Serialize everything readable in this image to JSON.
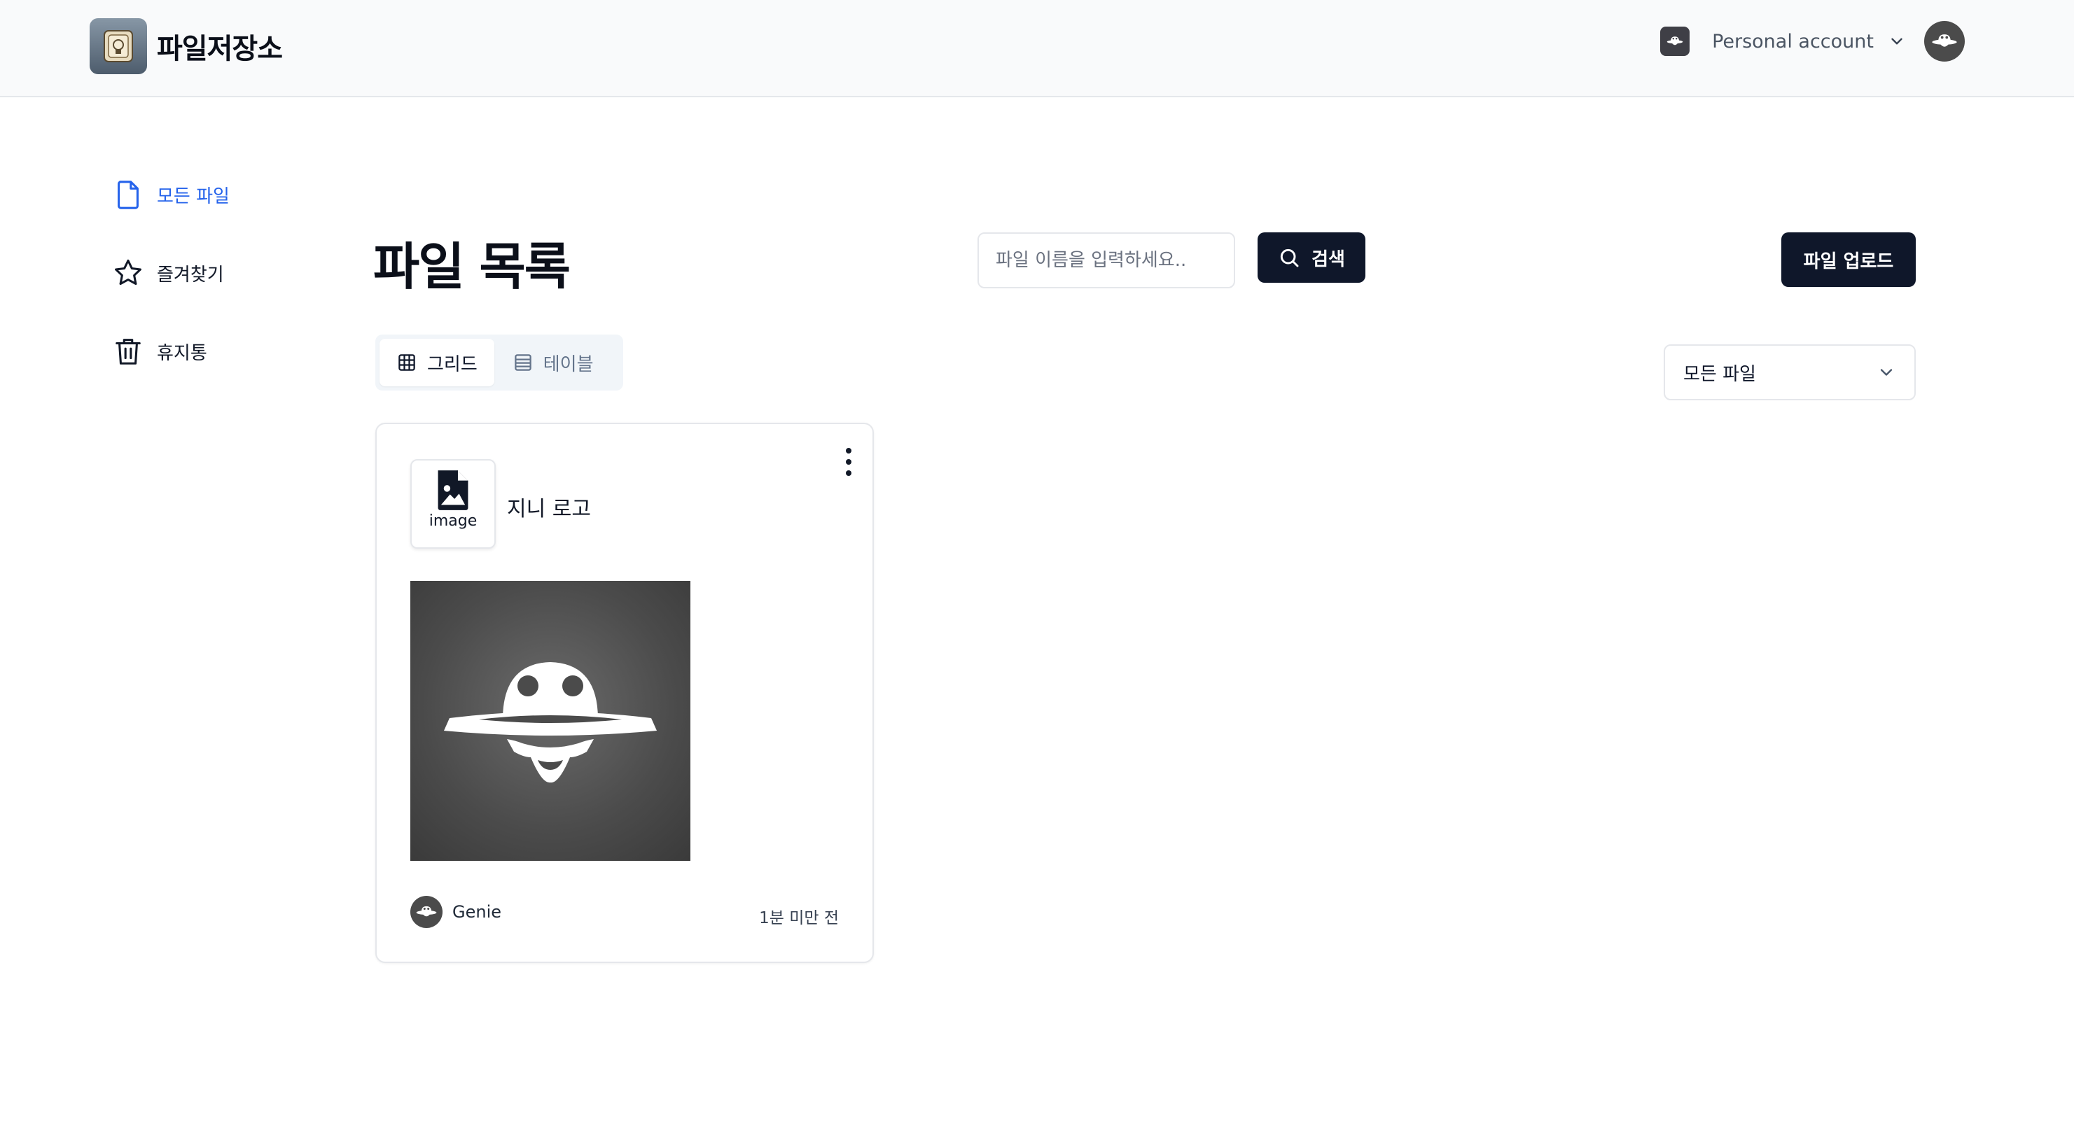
{
  "header": {
    "brand_name": "파일저장소",
    "account_label": "Personal account"
  },
  "sidebar": {
    "items": [
      {
        "label": "모든 파일",
        "icon": "file-icon",
        "active": true
      },
      {
        "label": "즐겨찾기",
        "icon": "star-icon",
        "active": false
      },
      {
        "label": "휴지통",
        "icon": "trash-icon",
        "active": false
      }
    ]
  },
  "main": {
    "title": "파일 목록",
    "search": {
      "placeholder": "파일 이름을 입력하세요..",
      "value": "",
      "button_label": "검색"
    },
    "upload_label": "파일 업로드",
    "view_toggle": {
      "grid_label": "그리드",
      "table_label": "테이블",
      "selected": "grid"
    },
    "filter": {
      "selected": "모든 파일"
    }
  },
  "files": [
    {
      "name": "지니 로고",
      "type_label": "image",
      "owner": "Genie",
      "time": "1분 미만 전"
    }
  ],
  "colors": {
    "primary": "#0f172a",
    "accent": "#2563eb",
    "header_bg": "#f9fafb",
    "border": "#e5e7eb"
  }
}
